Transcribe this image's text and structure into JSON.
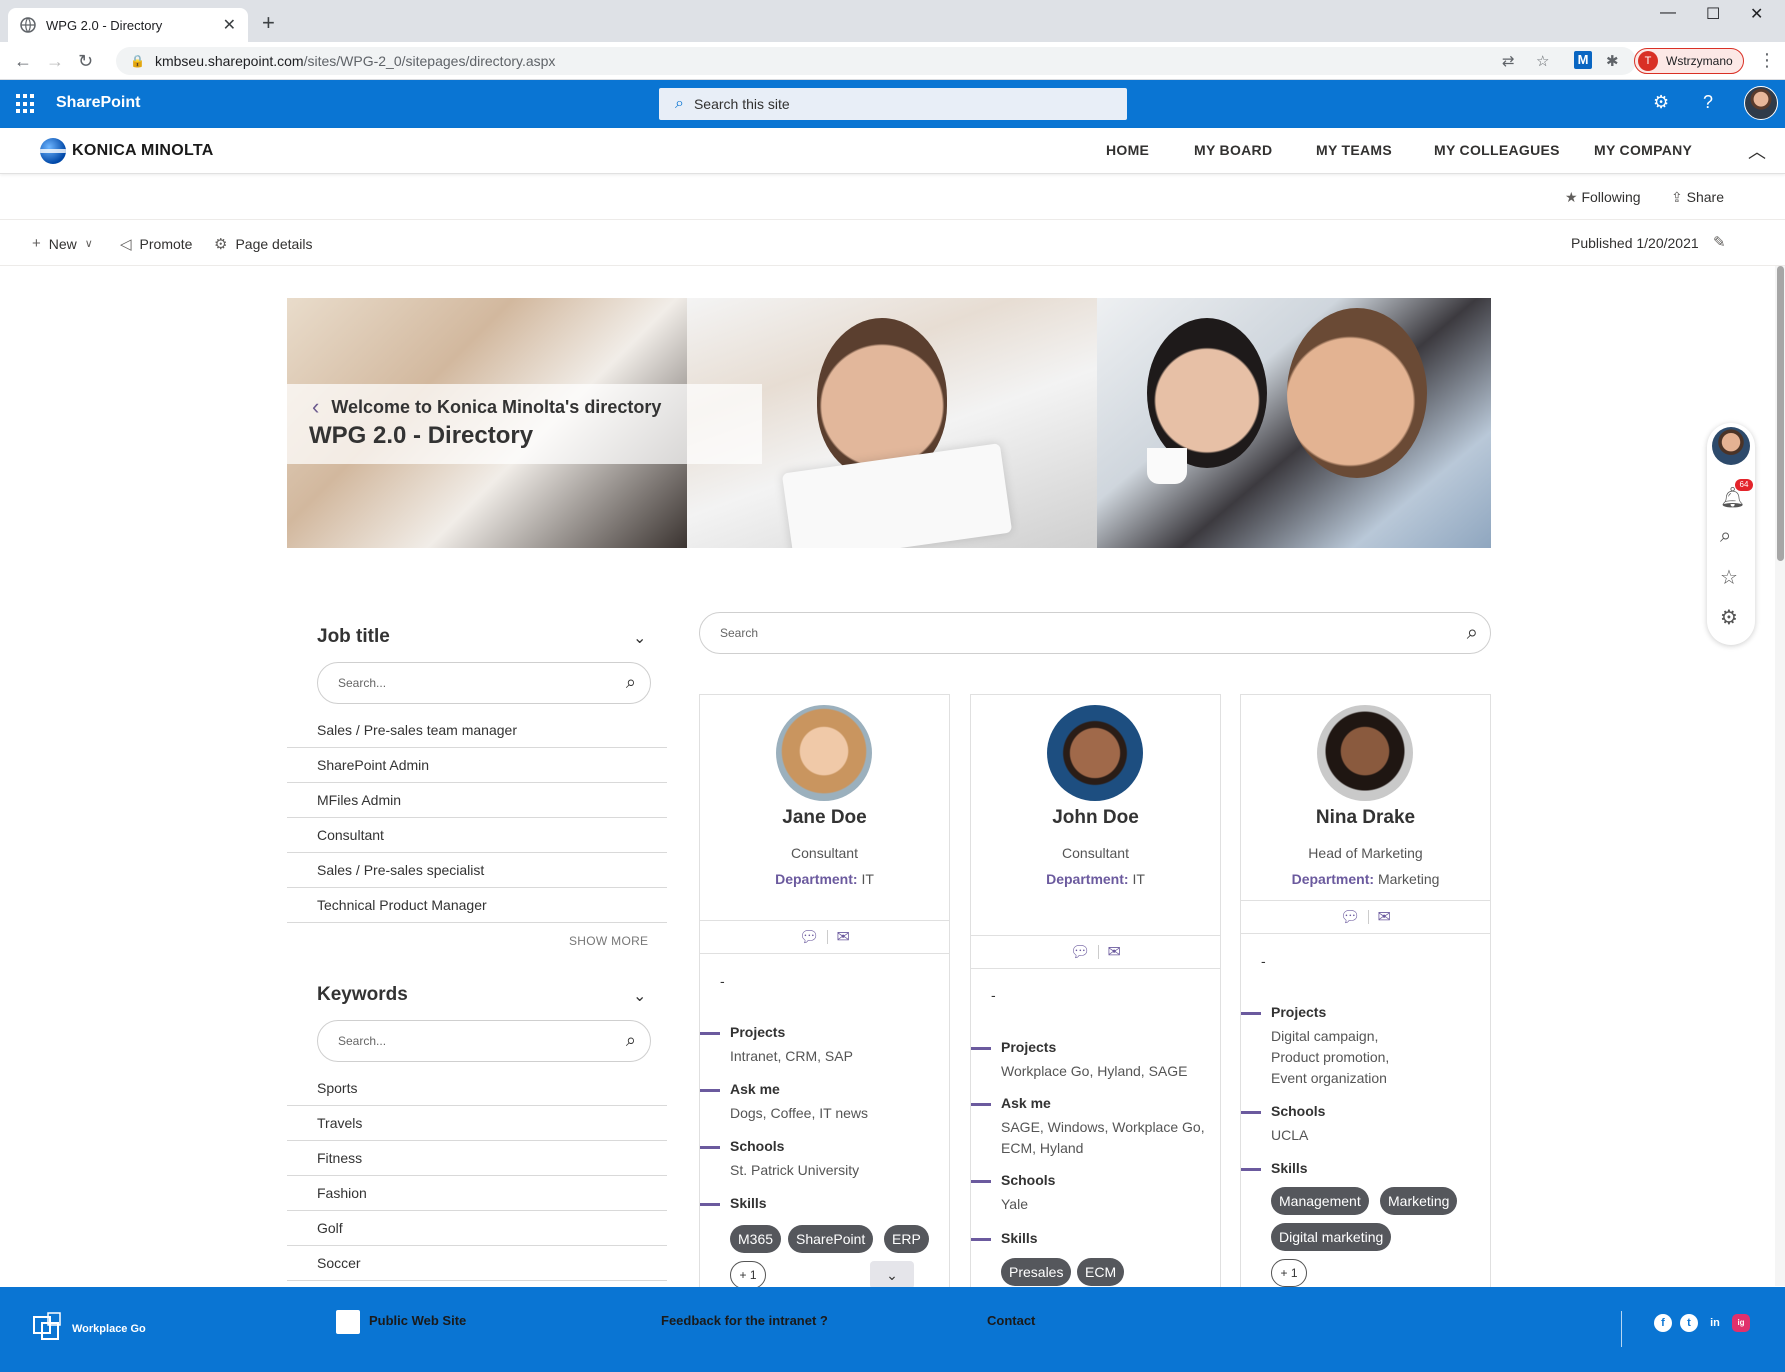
{
  "browser": {
    "tab_title": "WPG 2.0 - Directory",
    "url_host": "kmbseu.sharepoint.com",
    "url_path": "/sites/WPG-2_0/sitepages/directory.aspx",
    "profile_label": "Wstrzymano",
    "profile_initial": "T"
  },
  "suite": {
    "brand": "SharePoint",
    "search_placeholder": "Search this site"
  },
  "site": {
    "logo_text": "KONICA MINOLTA",
    "nav": [
      "HOME",
      "MY BOARD",
      "MY TEAMS",
      "MY COLLEAGUES",
      "MY COMPANY"
    ]
  },
  "page_actions": {
    "following": "Following",
    "share": "Share",
    "new": "New",
    "promote": "Promote",
    "page_details": "Page details",
    "published": "Published 1/20/2021"
  },
  "hero": {
    "subtitle": "Welcome to Konica Minolta's directory",
    "title": "WPG 2.0 - Directory"
  },
  "toolbar": {
    "notification_count": "64"
  },
  "filters": {
    "job_title": {
      "title": "Job title",
      "search_placeholder": "Search...",
      "items": [
        "Sales / Pre-sales team manager",
        "SharePoint Admin",
        "MFiles Admin",
        "Consultant",
        "Sales / Pre-sales specialist",
        "Technical Product Manager"
      ],
      "show_more": "SHOW MORE"
    },
    "keywords": {
      "title": "Keywords",
      "search_placeholder": "Search...",
      "items": [
        "Sports",
        "Travels",
        "Fitness",
        "Fashion",
        "Golf",
        "Soccer"
      ]
    }
  },
  "people_search": {
    "placeholder": "Search"
  },
  "labels": {
    "department": "Department:",
    "projects": "Projects",
    "ask_me": "Ask me",
    "schools": "Schools",
    "skills": "Skills",
    "dash": "-"
  },
  "people": [
    {
      "name": "Jane Doe",
      "job_title": "Consultant",
      "department": "IT",
      "projects": "Intranet, CRM, SAP",
      "ask_me": "Dogs, Coffee, IT news",
      "schools": "St. Patrick University",
      "skills": [
        "M365",
        "SharePoint",
        "ERP"
      ],
      "more": "+ 1"
    },
    {
      "name": "John Doe",
      "job_title": "Consultant",
      "department": "IT",
      "projects": "Workplace Go, Hyland, SAGE",
      "ask_me": "SAGE, Windows, Workplace Go, ECM, Hyland",
      "schools": "Yale",
      "skills": [
        "Presales",
        "ECM"
      ]
    },
    {
      "name": "Nina Drake",
      "job_title": "Head of Marketing",
      "department": "Marketing",
      "projects": "Digital campaign, Product promotion, Event organization",
      "schools": "UCLA",
      "skills": [
        "Management",
        "Marketing",
        "Digital marketing"
      ],
      "more": "+ 1"
    }
  ],
  "footer": {
    "brand": "Workplace Go",
    "public_site": "Public Web Site",
    "feedback": "Feedback for the intranet ?",
    "contact": "Contact",
    "social": [
      "f",
      "t",
      "in",
      "ig"
    ]
  },
  "colors": {
    "sharepoint_blue": "#0a75d3",
    "accent_purple": "#6b5a9e",
    "chip_gray": "#55575c"
  }
}
